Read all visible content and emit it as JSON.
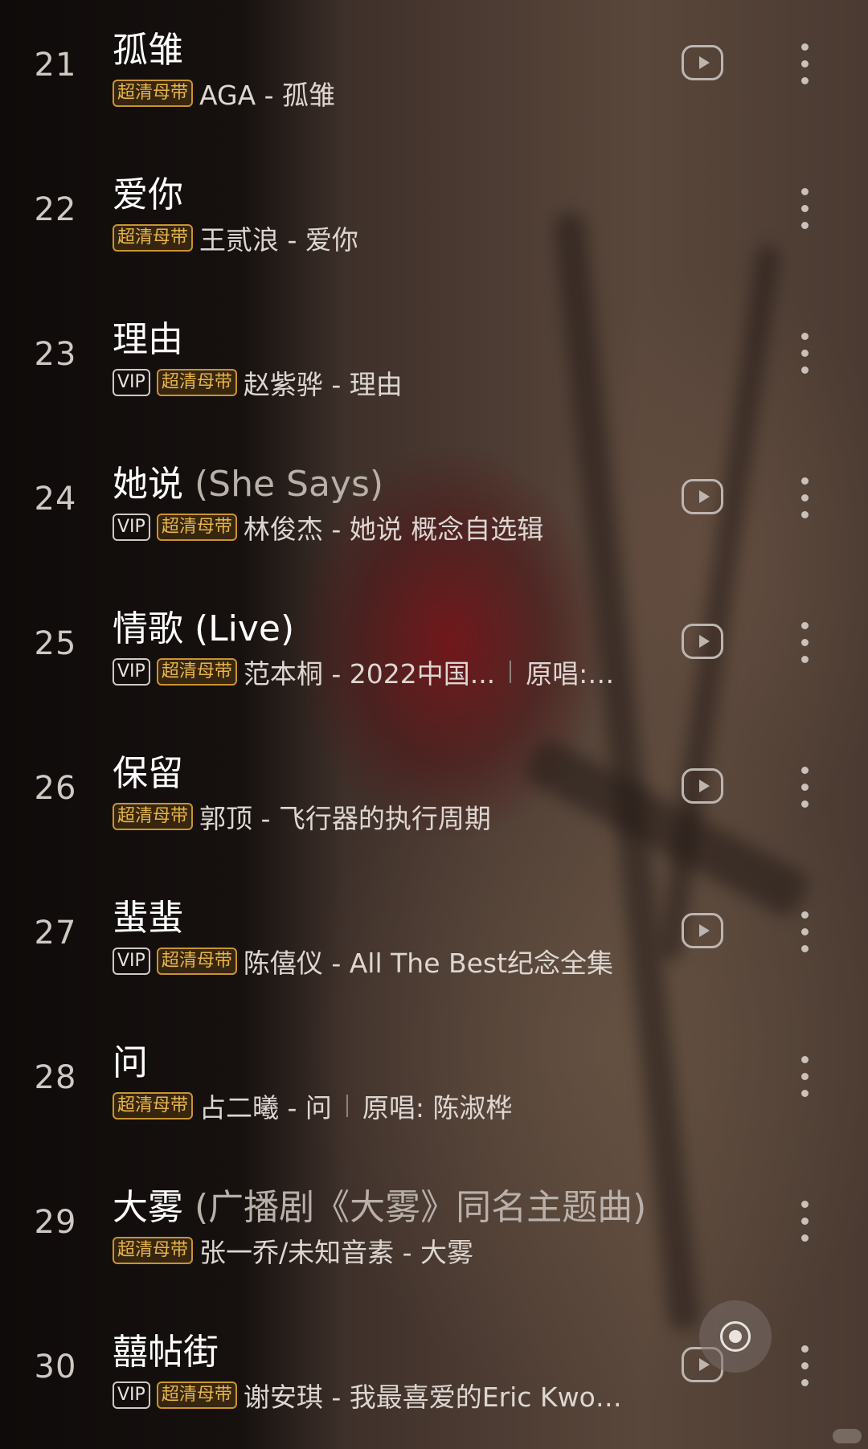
{
  "badges": {
    "vip": "VIP",
    "hq": "超清母带"
  },
  "songs": [
    {
      "rank": "21",
      "title": "孤雏",
      "subtitle": "",
      "vip": false,
      "artist": "AGA - 孤雏",
      "original": "",
      "has_mv": true
    },
    {
      "rank": "22",
      "title": "爱你",
      "subtitle": "",
      "vip": false,
      "artist": "王贰浪 - 爱你",
      "original": "",
      "has_mv": false
    },
    {
      "rank": "23",
      "title": "理由",
      "subtitle": "",
      "vip": true,
      "artist": "赵紫骅 - 理由",
      "original": "",
      "has_mv": false
    },
    {
      "rank": "24",
      "title": "她说",
      "subtitle": "(She Says)",
      "vip": true,
      "artist": "林俊杰 - 她说 概念自选辑",
      "original": "",
      "has_mv": true
    },
    {
      "rank": "25",
      "title": "情歌 (Live)",
      "subtitle": "",
      "vip": true,
      "artist": "范本桐 - 2022中国...",
      "original": "原唱:…",
      "has_mv": true
    },
    {
      "rank": "26",
      "title": "保留",
      "subtitle": "",
      "vip": false,
      "artist": "郭顶 - 飞行器的执行周期",
      "original": "",
      "has_mv": true
    },
    {
      "rank": "27",
      "title": "蜚蜚",
      "subtitle": "",
      "vip": true,
      "artist": "陈僖仪 - All The Best纪念全集",
      "original": "",
      "has_mv": true
    },
    {
      "rank": "28",
      "title": "问",
      "subtitle": "",
      "vip": false,
      "artist": "占二曦 - 问",
      "original": "原唱: 陈淑桦",
      "has_mv": false
    },
    {
      "rank": "29",
      "title": "大雾",
      "subtitle": "(广播剧《大雾》同名主题曲)",
      "vip": false,
      "artist": "张一乔/未知音素 - 大雾",
      "original": "",
      "has_mv": false
    },
    {
      "rank": "30",
      "title": "囍帖街",
      "subtitle": "",
      "vip": true,
      "artist": "谢安琪 - 我最喜爱的Eric Kwo…",
      "original": "",
      "has_mv": true
    }
  ],
  "icons": {
    "mv": "play-video-icon",
    "more": "more-vertical-icon",
    "float": "locate-target-icon"
  }
}
